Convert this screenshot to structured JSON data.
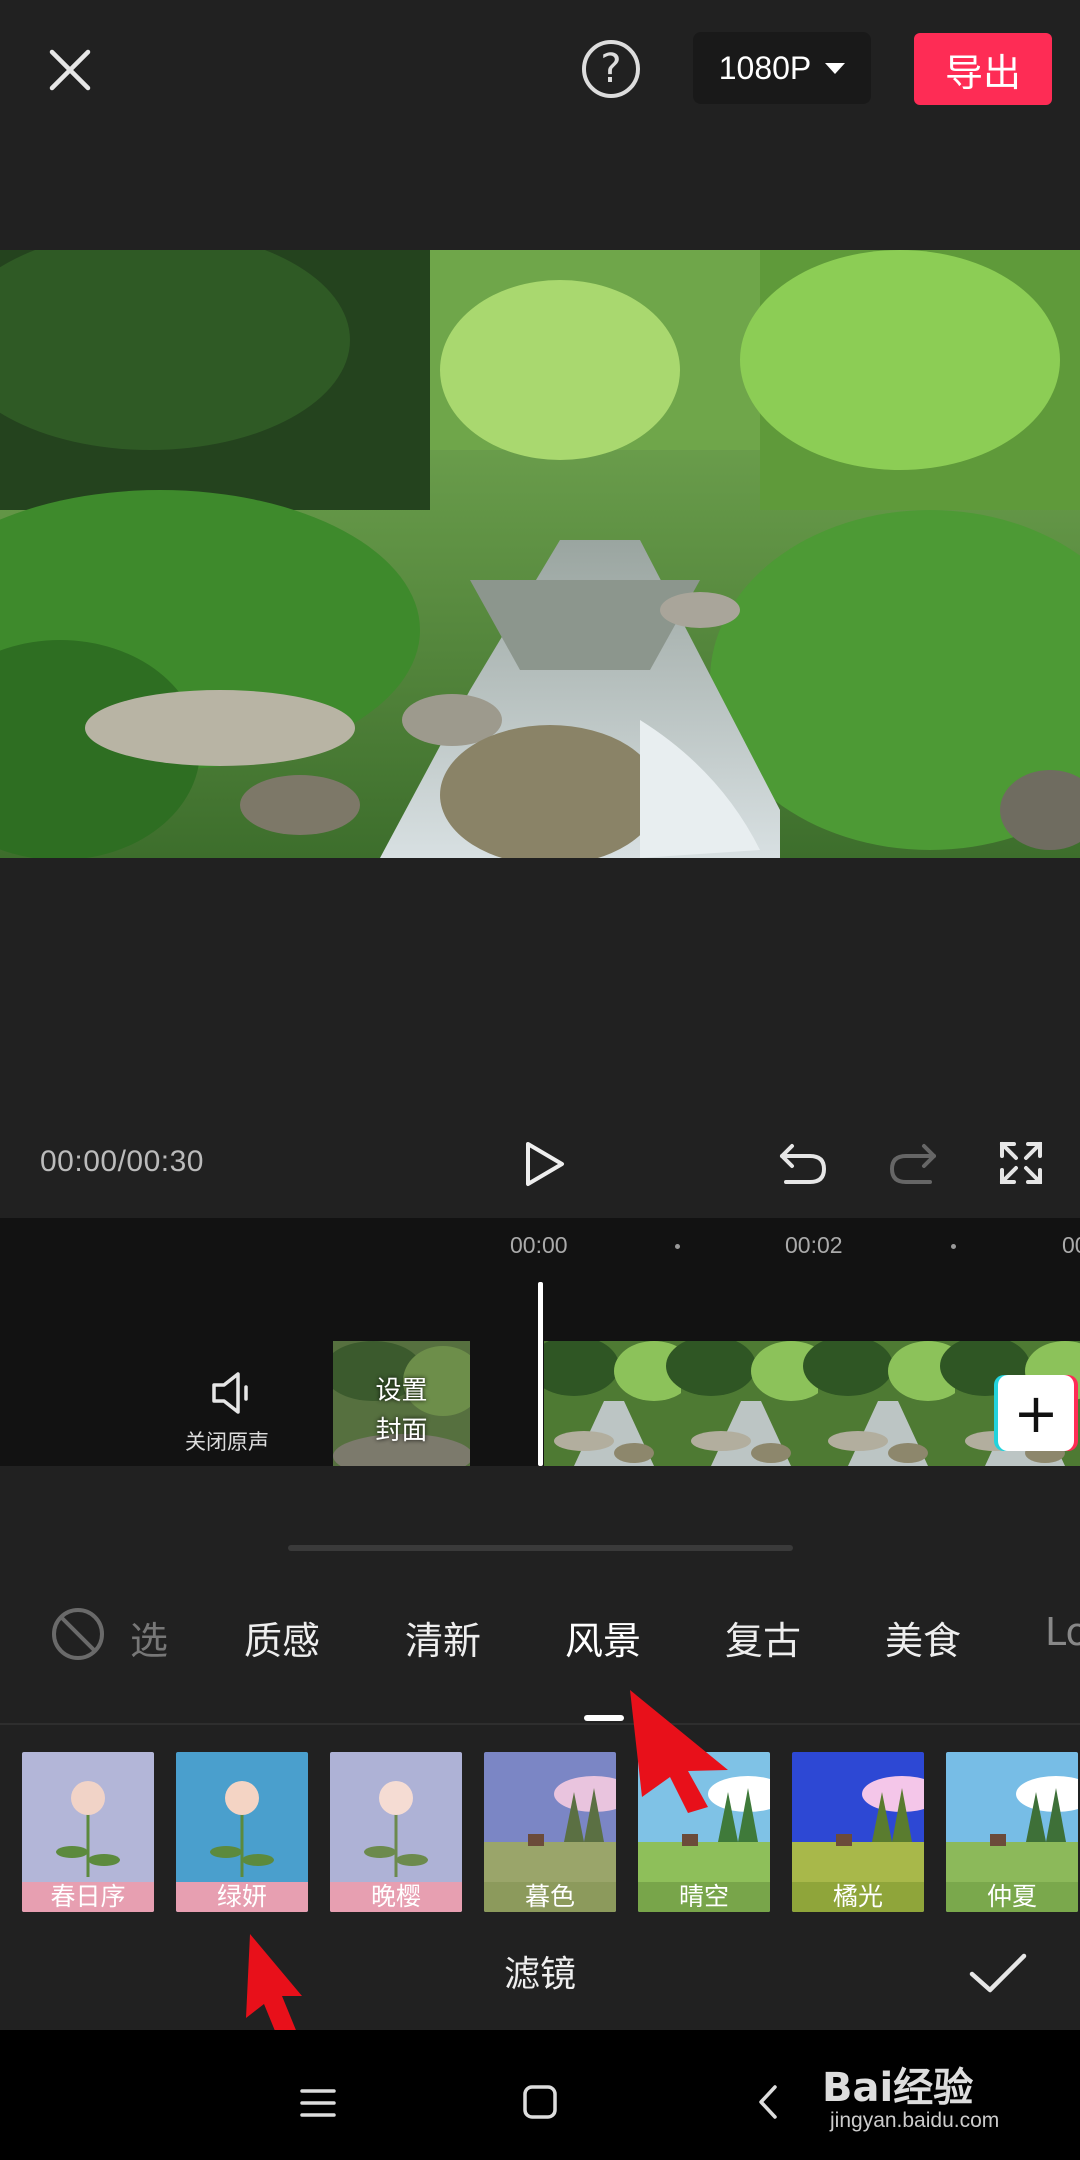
{
  "top_bar": {
    "resolution_label": "1080P",
    "export_label": "导出",
    "help_label": "?"
  },
  "playback": {
    "timecode": "00:00/00:30"
  },
  "timeline": {
    "ruler": [
      "00:00",
      "00:02",
      "00"
    ],
    "mute_label": "关闭原声",
    "cover_line1": "设置",
    "cover_line2": "封面"
  },
  "filter_panel": {
    "categories": [
      "选",
      "质感",
      "清新",
      "风景",
      "复古",
      "美食",
      "Lo"
    ],
    "selected_category": "风景",
    "filters": [
      "春日序",
      "绿妍",
      "晚樱",
      "暮色",
      "晴空",
      "橘光",
      "仲夏"
    ],
    "title": "滤镜"
  },
  "watermark": {
    "brand": "Bai经验",
    "url": "jingyan.baidu.com"
  },
  "colors": {
    "accent": "#fe2c55",
    "background": "#212121",
    "annotation_arrow": "#e8101a"
  }
}
